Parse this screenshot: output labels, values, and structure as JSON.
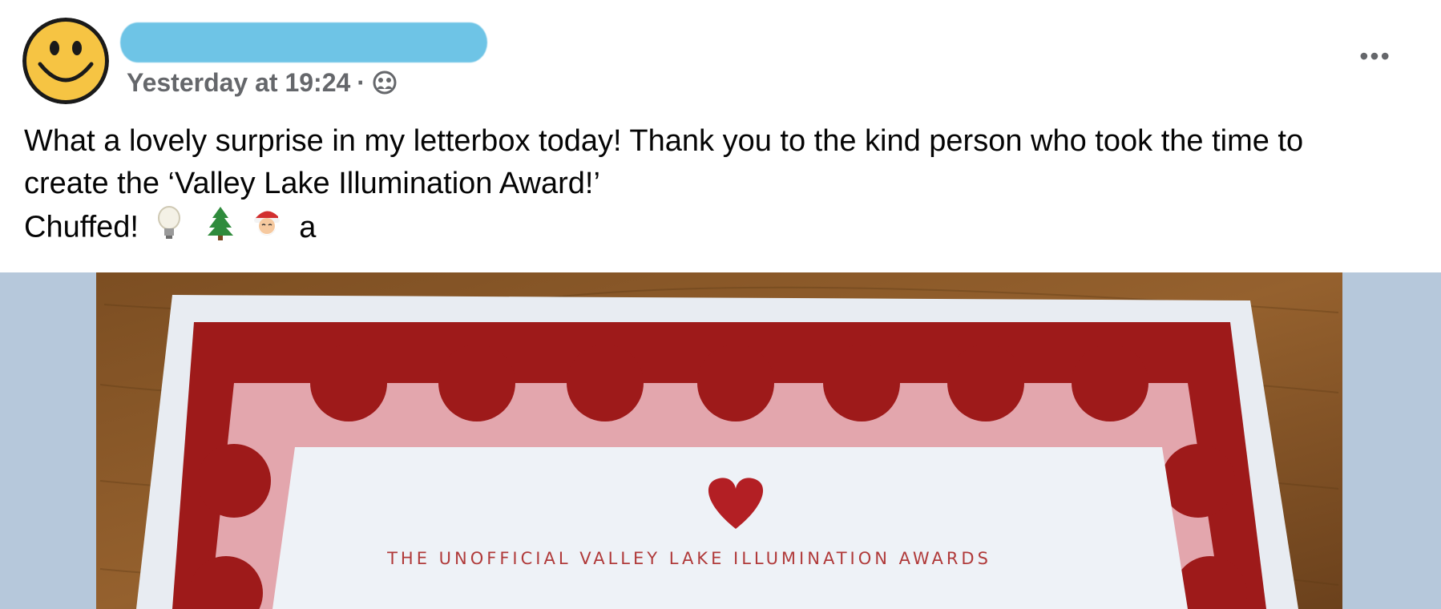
{
  "post": {
    "author": "",
    "timestamp": "Yesterday at 19:24",
    "separator": "·",
    "audience_icon": "friends-audience-icon",
    "more_label": "•••",
    "text_lines": [
      "What a lovely surprise in my letterbox today! Thank you to the kind person who took the time to",
      "create the ‘Valley Lake Illumination Award!’"
    ],
    "last_line": "Chuffed!",
    "emojis": [
      "light-bulb-icon",
      "christmas-tree-icon",
      "santa-icon"
    ],
    "trailing": "a"
  },
  "photo": {
    "certificate_title": "THE UNOFFICIAL VALLEY LAKE ILLUMINATION AWARDS",
    "colors": {
      "background": "#b6c8db",
      "table": "#8a5a2b",
      "border_red": "#9e1a1a",
      "inner_pink": "#e3a6ad",
      "paper": "#eef2f7"
    }
  },
  "colors": {
    "meta_text": "#65676b",
    "body_text": "#050505",
    "redaction": "#6ec4e6"
  }
}
